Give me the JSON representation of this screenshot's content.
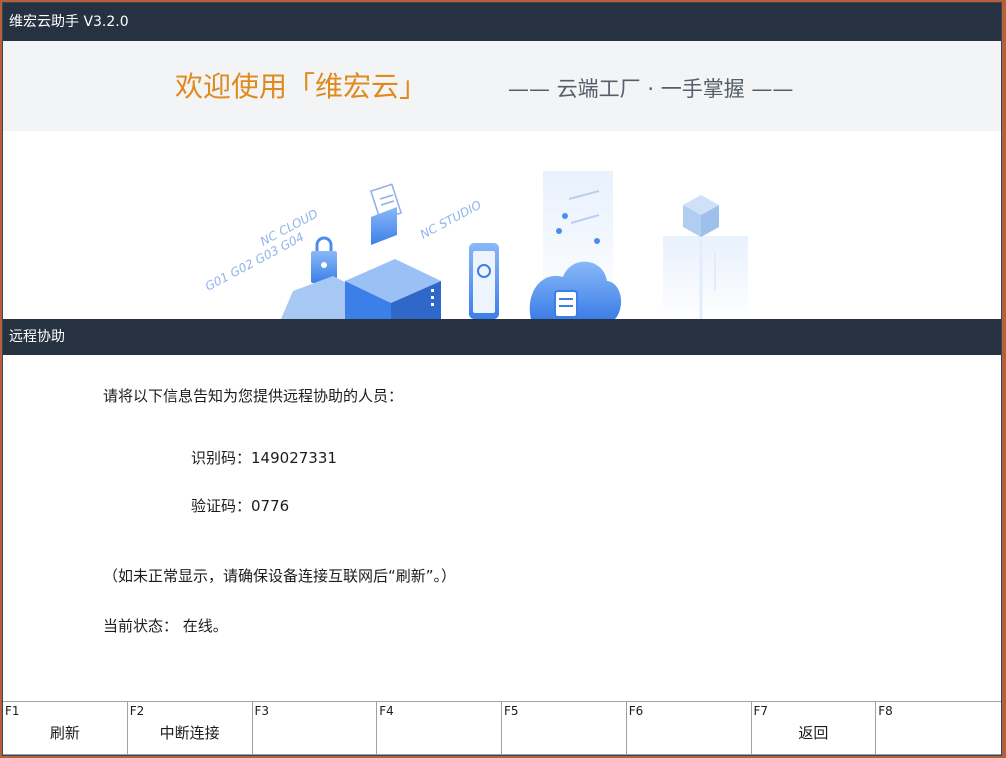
{
  "window": {
    "title": "维宏云助手 V3.2.0"
  },
  "banner": {
    "welcome": "欢迎使用「维宏云」",
    "slogan": "—— 云端工厂 · 一手掌握 ——"
  },
  "illustration": {
    "nc_cloud": "NC CLOUD",
    "gcodes": "G01 G02 G03 G04",
    "nc_studio": "NC STUDIO"
  },
  "section": {
    "title": "远程协助"
  },
  "remote": {
    "instruction": "请将以下信息告知为您提供远程协助的人员：",
    "id_label": "识别码：",
    "id_value": "149027331",
    "verify_label": "验证码：",
    "verify_value": "0776",
    "hint": "（如未正常显示，请确保设备连接互联网后“刷新”。）",
    "status_label": "当前状态：",
    "status_value": "在线。"
  },
  "function_keys": [
    {
      "key": "F1",
      "label": "刷新"
    },
    {
      "key": "F2",
      "label": "中断连接"
    },
    {
      "key": "F3",
      "label": ""
    },
    {
      "key": "F4",
      "label": ""
    },
    {
      "key": "F5",
      "label": ""
    },
    {
      "key": "F6",
      "label": ""
    },
    {
      "key": "F7",
      "label": "返回"
    },
    {
      "key": "F8",
      "label": ""
    }
  ],
  "colors": {
    "titlebar_bg": "#263141",
    "welcome_text": "#e08a1d",
    "illustration_blue": "#4a8cf0"
  }
}
